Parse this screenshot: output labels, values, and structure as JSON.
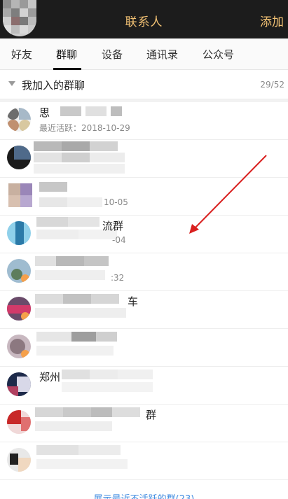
{
  "header": {
    "title": "联系人",
    "add_label": "添加"
  },
  "tabs": [
    {
      "label": "好友"
    },
    {
      "label": "群聊"
    },
    {
      "label": "设备"
    },
    {
      "label": "通讯录"
    },
    {
      "label": "公众号"
    }
  ],
  "section": {
    "label": "我加入的群聊",
    "count": "29/52"
  },
  "groups": [
    {
      "name": "思",
      "sub": "最近活跃：2018-10-29"
    },
    {
      "name": "",
      "sub": ""
    },
    {
      "name": "",
      "sub": "10-05"
    },
    {
      "name": "流群",
      "sub": "-04"
    },
    {
      "name": "",
      "sub": ":32"
    },
    {
      "name": "车",
      "sub": ""
    },
    {
      "name": "",
      "sub": ""
    },
    {
      "name": "郑州",
      "sub": ""
    },
    {
      "name": "群",
      "sub": ""
    },
    {
      "name": "",
      "sub": ""
    }
  ],
  "footer": {
    "link": "展示最近不活跃的群(23)"
  },
  "colors": {
    "accent": "#f3c274",
    "link": "#3f8be0",
    "annotation_arrow": "#d9201f"
  }
}
